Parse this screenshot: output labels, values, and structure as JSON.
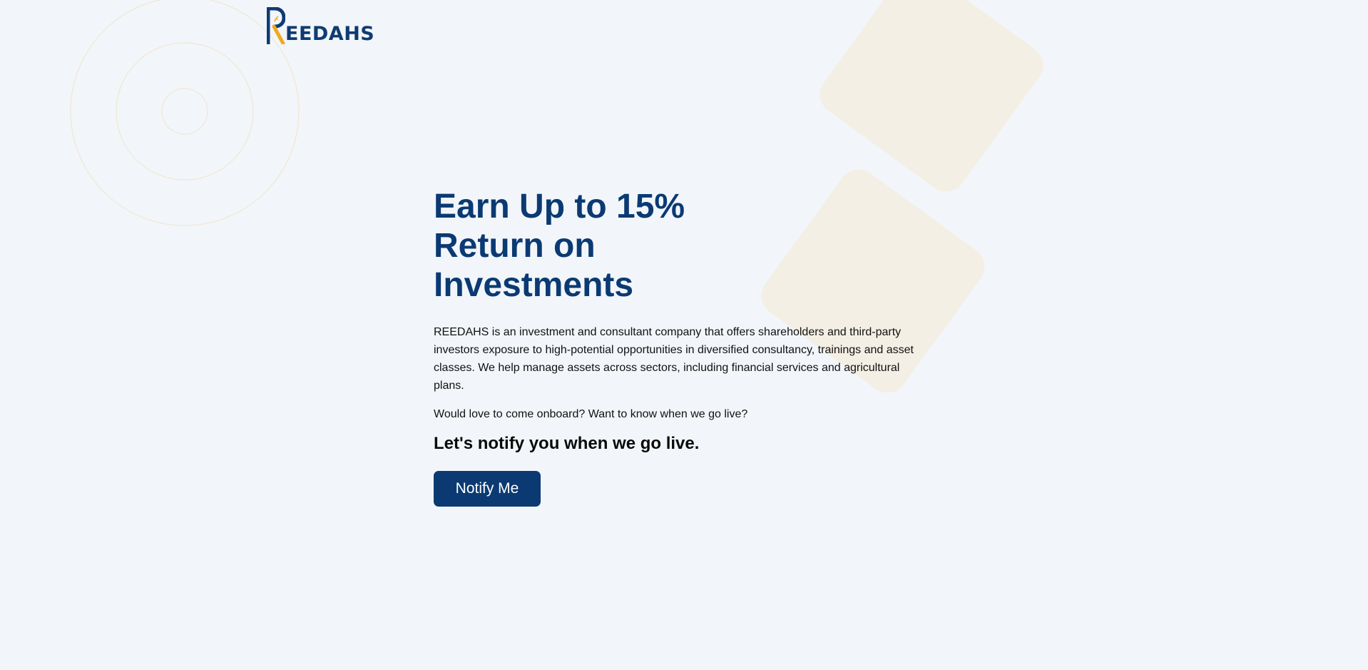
{
  "brand": {
    "logo_text": "EEDAHS",
    "logo_initial": "R",
    "primary_color": "#0b3a73",
    "accent_color": "#f2a91f"
  },
  "hero": {
    "headline": "Earn Up to 15% Return on Investments",
    "description": "REEDAHS is an investment and consultant company that offers shareholders and third-party investors exposure to high-potential opportunities in diversified consultancy, trainings and asset classes. We help manage assets across sectors, including financial services and agricultural plans.",
    "question": "Would love to come onboard? Want to know when we go live?",
    "notify_heading": "Let's notify you when we go live.",
    "notify_button_label": "Notify Me"
  },
  "decor": {
    "circle_color": "#f2e5d2",
    "diamond_color": "#f4efe4"
  }
}
